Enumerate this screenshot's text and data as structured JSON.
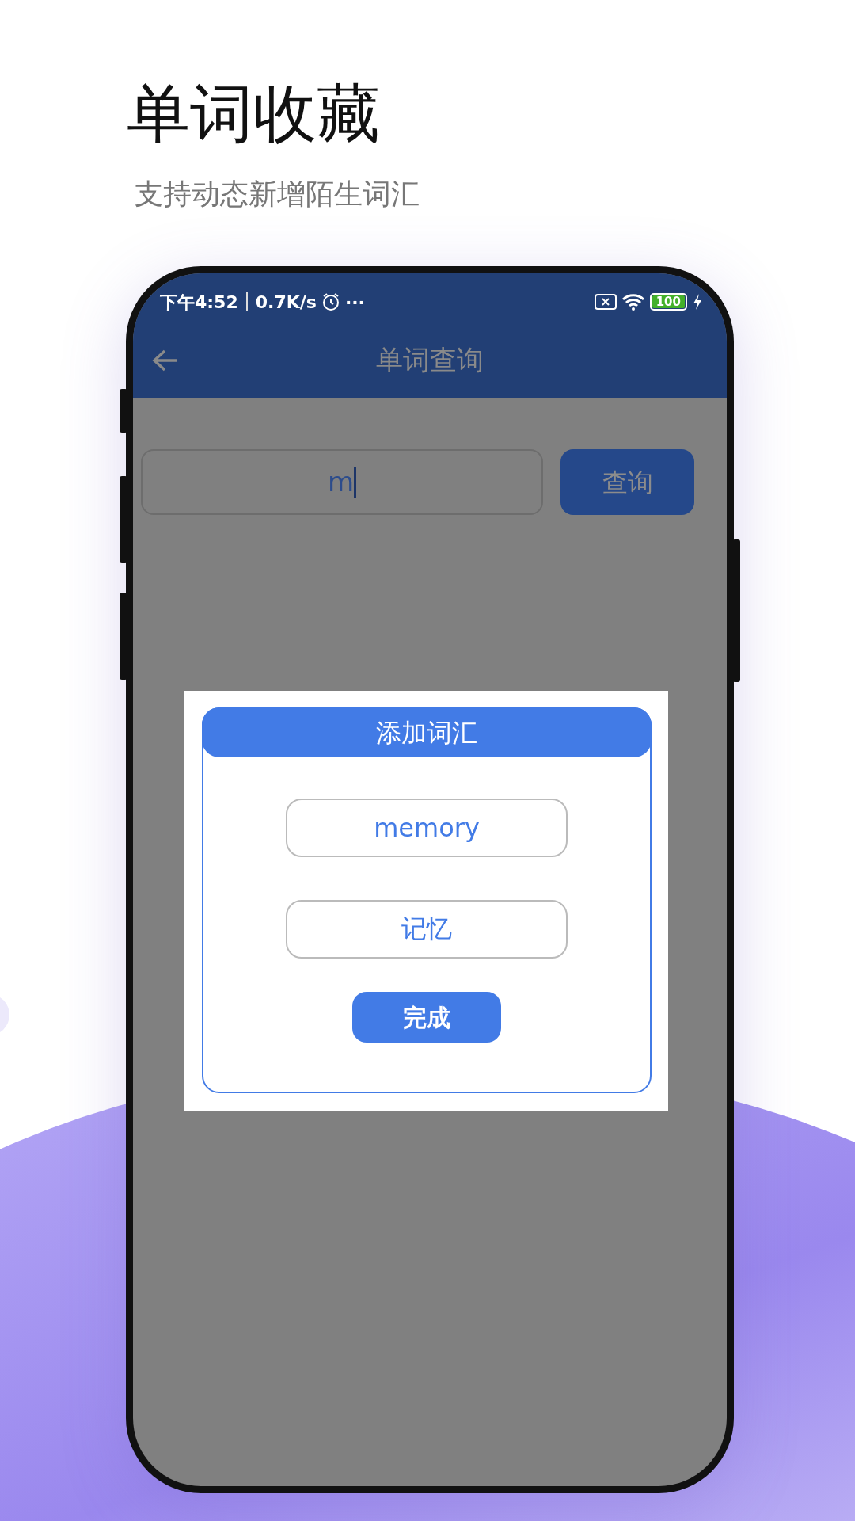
{
  "headline": "单词收藏",
  "subtitle": "支持动态新增陌生词汇",
  "status_bar": {
    "time": "下午4:52",
    "speed": "0.7K/s",
    "more": "···",
    "battery": "100",
    "charging": true
  },
  "app_bar": {
    "title": "单词查询"
  },
  "search": {
    "value": "m",
    "button": "查询"
  },
  "dialog": {
    "title": "添加词汇",
    "fields": [
      {
        "value": "memory"
      },
      {
        "value": "记忆"
      }
    ],
    "button": "完成"
  }
}
